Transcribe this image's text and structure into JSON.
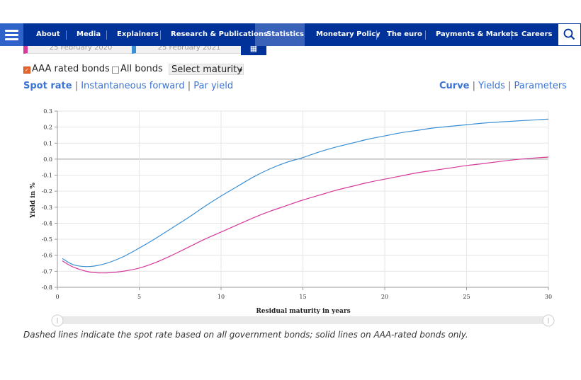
{
  "nav": {
    "items": [
      "About",
      "Media",
      "Explainers",
      "Research & Publications",
      "Statistics",
      "Monetary Policy",
      "The euro",
      "Payments & Markets",
      "Careers"
    ],
    "active": "Statistics"
  },
  "dates": {
    "date1": "25 February 2020",
    "date2": "25 February 2021"
  },
  "controls": {
    "aaa_label": "AAA rated bonds",
    "aaa_checked": true,
    "all_label": "All bonds",
    "all_checked": false,
    "select_label": "Select maturity"
  },
  "tabs_left": [
    "Spot rate",
    "Instantaneous forward",
    "Par yield"
  ],
  "tabs_right": [
    "Curve",
    "Yields",
    "Parameters"
  ],
  "caption": "Dashed lines indicate the spot rate based on all government bonds; solid lines on AAA-rated bonds only.",
  "chart_data": {
    "type": "line",
    "xlabel": "Residual maturity in years",
    "ylabel": "Yield in %",
    "xlim": [
      0,
      30
    ],
    "ylim": [
      -0.8,
      0.3
    ],
    "xticks": [
      0,
      5,
      10,
      15,
      20,
      25,
      30
    ],
    "yticks": [
      0.3,
      0.2,
      0.1,
      0.0,
      -0.1,
      -0.2,
      -0.3,
      -0.4,
      -0.5,
      -0.6,
      -0.7,
      -0.8
    ],
    "grid": true,
    "series": [
      {
        "color": "#3a8fd6",
        "x": [
          0.3,
          1,
          2,
          3,
          4,
          5,
          6,
          7,
          8,
          9,
          10,
          11,
          12,
          13,
          14,
          15,
          16,
          17,
          18,
          19,
          20,
          21,
          22,
          23,
          24,
          25,
          26,
          27,
          28,
          29,
          30
        ],
        "y": [
          -0.62,
          -0.66,
          -0.67,
          -0.65,
          -0.61,
          -0.555,
          -0.495,
          -0.43,
          -0.365,
          -0.295,
          -0.23,
          -0.17,
          -0.11,
          -0.06,
          -0.02,
          0.01,
          0.045,
          0.075,
          0.1,
          0.125,
          0.145,
          0.165,
          0.18,
          0.195,
          0.205,
          0.215,
          0.225,
          0.232,
          0.238,
          0.244,
          0.25
        ]
      },
      {
        "color": "#d6399b",
        "x": [
          0.3,
          1,
          2,
          3,
          4,
          5,
          6,
          7,
          8,
          9,
          10,
          11,
          12,
          13,
          14,
          15,
          16,
          17,
          18,
          19,
          20,
          21,
          22,
          23,
          24,
          25,
          26,
          27,
          28,
          29,
          30
        ],
        "y": [
          -0.635,
          -0.675,
          -0.705,
          -0.71,
          -0.7,
          -0.68,
          -0.645,
          -0.6,
          -0.55,
          -0.5,
          -0.455,
          -0.41,
          -0.365,
          -0.325,
          -0.29,
          -0.255,
          -0.225,
          -0.195,
          -0.17,
          -0.145,
          -0.125,
          -0.105,
          -0.085,
          -0.07,
          -0.055,
          -0.04,
          -0.028,
          -0.015,
          -0.003,
          0.006,
          0.013
        ]
      }
    ]
  }
}
